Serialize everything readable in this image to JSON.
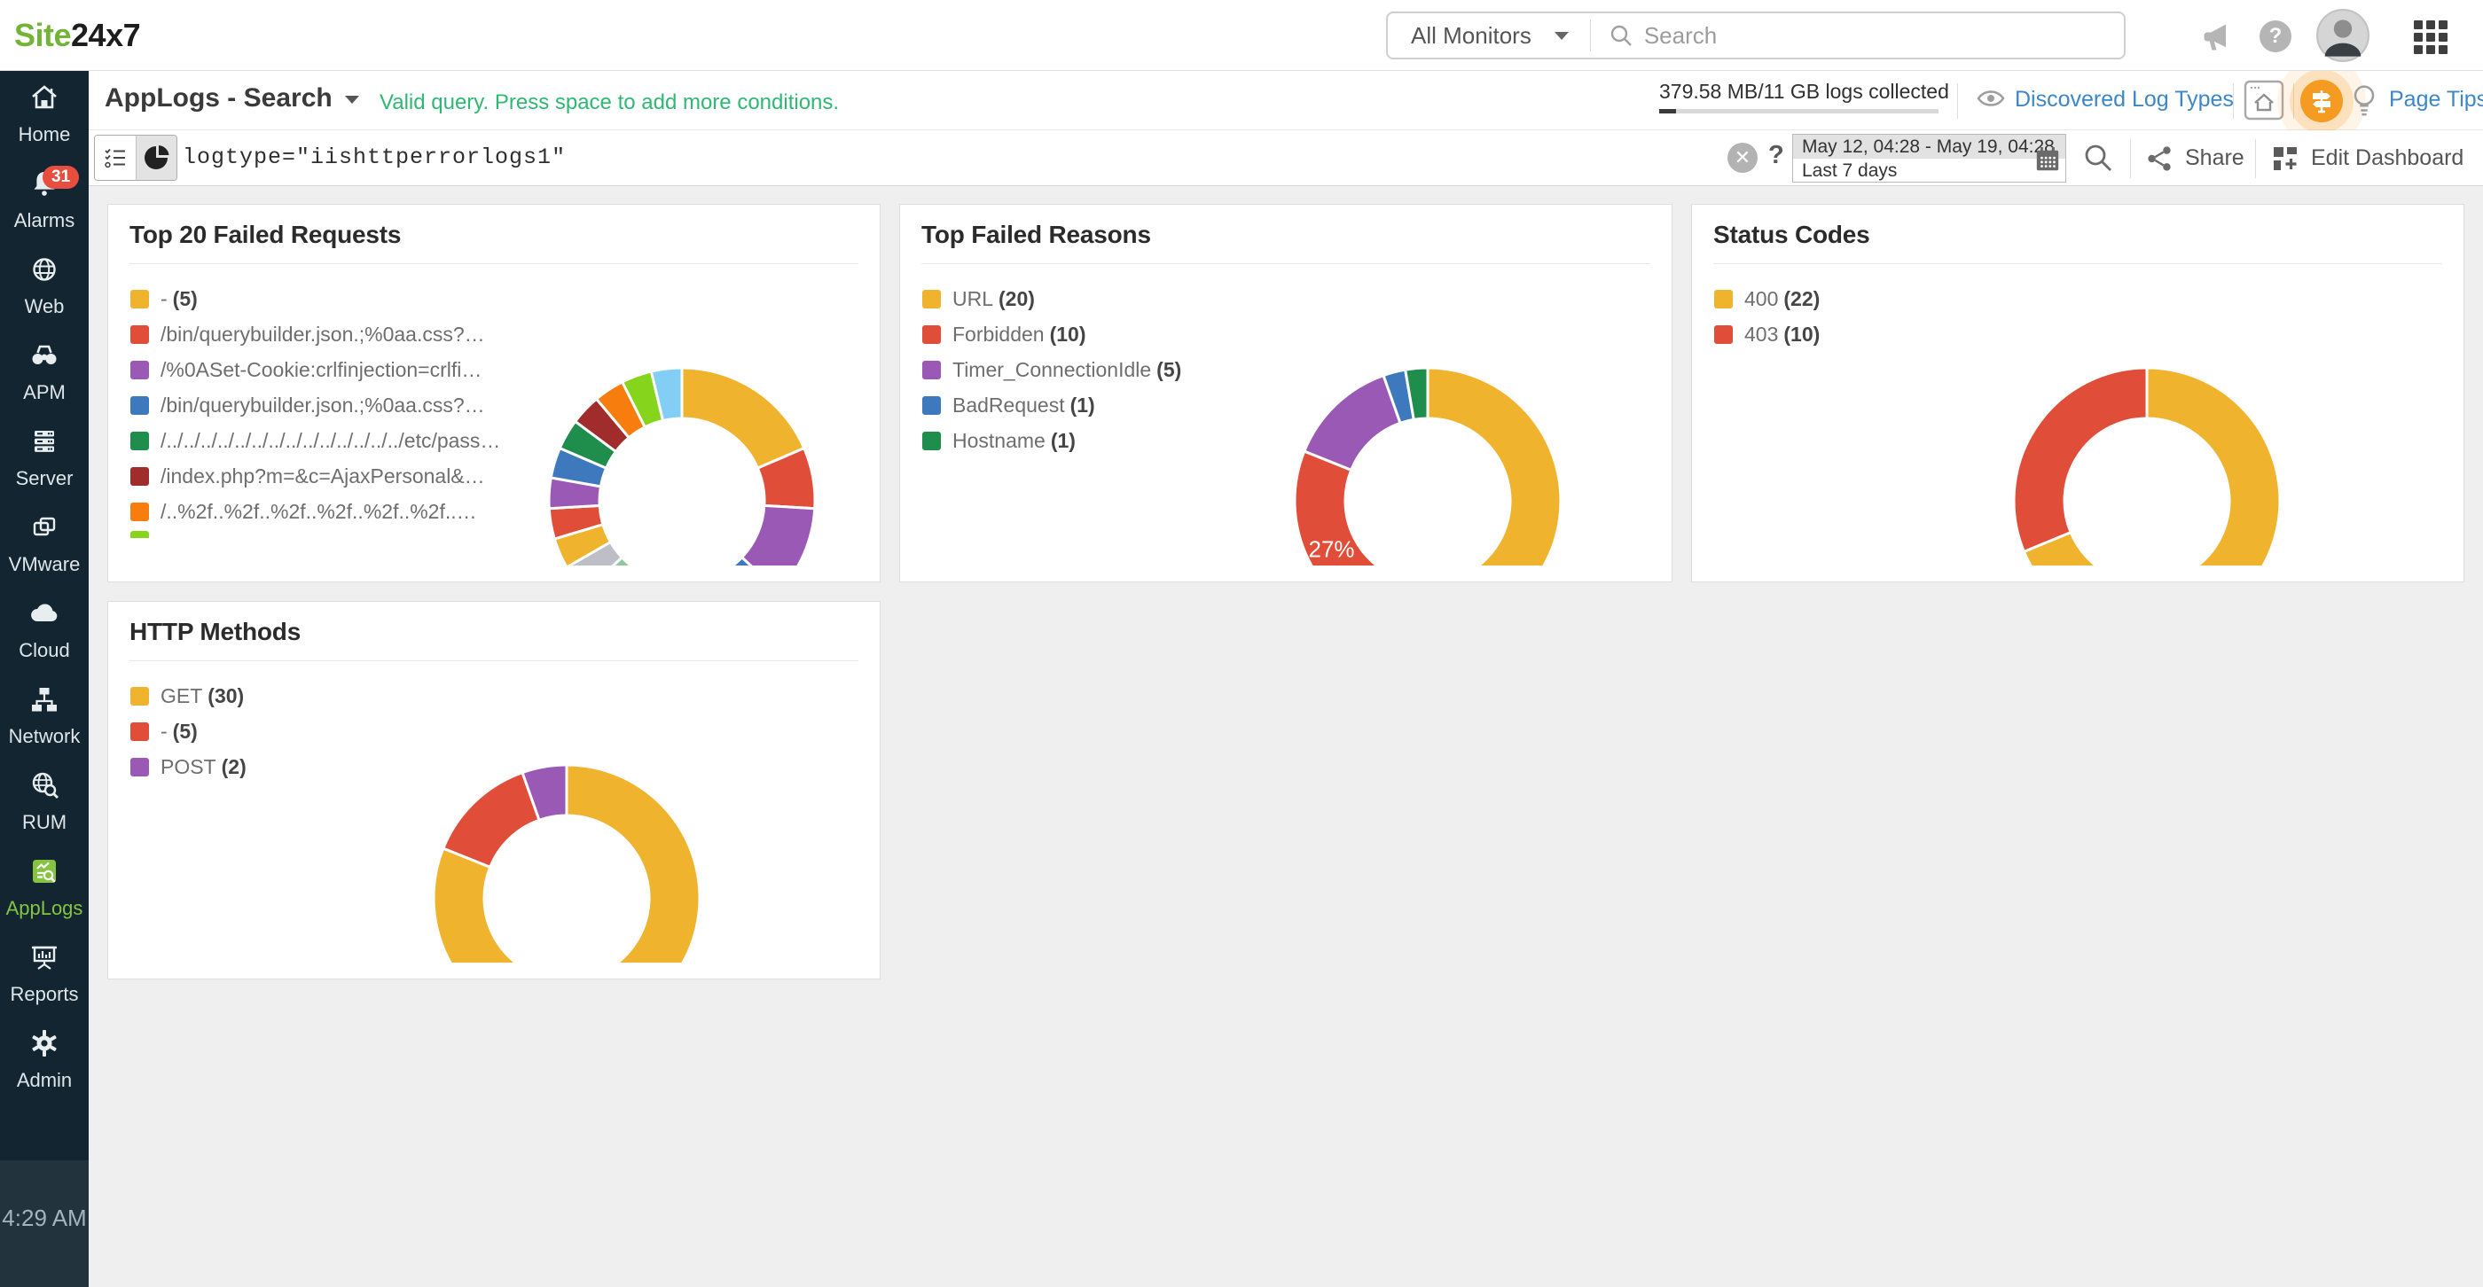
{
  "topbar": {
    "logo_green": "Site",
    "logo_dark": "24x7",
    "monitor_dropdown": "All Monitors",
    "search_placeholder": "Search"
  },
  "header": {
    "title": "AppLogs - Search",
    "hint": "Valid query. Press space to add more conditions.",
    "usage_text": "379.58 MB/11 GB logs collected",
    "usage_pct": 6,
    "discovered_link": "Discovered Log Types",
    "page_tips": "Page Tips"
  },
  "querybar": {
    "query": "logtype=\"iishttperrorlogs1\"",
    "date_range": "May 12, 04:28 - May 19, 04:28",
    "date_preset": "Last 7 days",
    "share_label": "Share",
    "edit_label": "Edit Dashboard"
  },
  "sidebar": {
    "items": [
      {
        "id": "home",
        "label": "Home"
      },
      {
        "id": "alarms",
        "label": "Alarms",
        "badge": "31"
      },
      {
        "id": "web",
        "label": "Web"
      },
      {
        "id": "apm",
        "label": "APM"
      },
      {
        "id": "server",
        "label": "Server"
      },
      {
        "id": "vmware",
        "label": "VMware"
      },
      {
        "id": "cloud",
        "label": "Cloud"
      },
      {
        "id": "network",
        "label": "Network"
      },
      {
        "id": "rum",
        "label": "RUM"
      },
      {
        "id": "applogs",
        "label": "AppLogs",
        "active": true
      },
      {
        "id": "reports",
        "label": "Reports"
      },
      {
        "id": "admin",
        "label": "Admin"
      }
    ],
    "time": "4:29 AM"
  },
  "colors": {
    "accent_green": "#85c440",
    "link_blue": "#3c87c6",
    "valid_green": "#2eb873",
    "alarm_red": "#e84e40",
    "sidebar_bg": "#132530",
    "tip_orange": "#f59b22"
  },
  "chart_data": [
    {
      "type": "donut",
      "title": "Top 20 Failed Requests",
      "legend": [
        {
          "label": "-",
          "count": "5",
          "color": "#F0B32E"
        },
        {
          "label": "/bin/querybuilder.json.;%0aa.css?…",
          "count": "",
          "color": "#E04E39"
        },
        {
          "label": "/%0ASet-Cookie:crlfinjection=crlfi…",
          "count": "",
          "color": "#9B59B6"
        },
        {
          "label": "/bin/querybuilder.json.;%0aa.css?…",
          "count": "",
          "color": "#3F79BD"
        },
        {
          "label": "/../../../../../../../../../../../../../../etc/pass…",
          "count": "",
          "color": "#1F8E4D"
        },
        {
          "label": "/index.php?m=&c=AjaxPersonal&…",
          "count": "",
          "color": "#A02C2C"
        },
        {
          "label": "/..%2f..%2f..%2f..%2f..%2f..%2f..…",
          "count": "",
          "color": "#F77E0E"
        }
      ],
      "legend_overflow_color": "#86D41C",
      "values": [
        5,
        2,
        3,
        1,
        1,
        1,
        1,
        1,
        1,
        1,
        1,
        1,
        1,
        1,
        1,
        1,
        1,
        1,
        1,
        1
      ],
      "segment_colors": [
        "#F0B32E",
        "#E04E39",
        "#9B59B6",
        "#3F79BD",
        "#1F8E4D",
        "#A02C2C",
        "#F77E0E",
        "#86D41C",
        "#82CEF5",
        "#8FC79B",
        "#BEBEC6",
        "#F0B32E",
        "#E04E39",
        "#9B59B6",
        "#3F79BD",
        "#1F8E4D",
        "#A02C2C",
        "#F77E0E",
        "#86D41C",
        "#82CEF5"
      ],
      "inner_label": null
    },
    {
      "type": "donut",
      "title": "Top Failed Reasons",
      "legend": [
        {
          "label": "URL",
          "count": "20",
          "color": "#F0B32E"
        },
        {
          "label": "Forbidden",
          "count": "10",
          "color": "#E04E39"
        },
        {
          "label": "Timer_ConnectionIdle",
          "count": "5",
          "color": "#9B59B6"
        },
        {
          "label": "BadRequest",
          "count": "1",
          "color": "#3F79BD"
        },
        {
          "label": "Hostname",
          "count": "1",
          "color": "#1F8E4D"
        }
      ],
      "values": [
        20,
        10,
        5,
        1,
        1
      ],
      "segment_colors": [
        "#F0B32E",
        "#E04E39",
        "#9B59B6",
        "#3F79BD",
        "#1F8E4D"
      ],
      "inner_label": {
        "text": "27%",
        "segment": 1
      }
    },
    {
      "type": "donut",
      "title": "Status Codes",
      "legend": [
        {
          "label": "400",
          "count": "22",
          "color": "#F0B32E"
        },
        {
          "label": "403",
          "count": "10",
          "color": "#E04E39"
        }
      ],
      "values": [
        22,
        10
      ],
      "segment_colors": [
        "#F0B32E",
        "#E04E39"
      ],
      "inner_label": null
    },
    {
      "type": "donut",
      "title": "HTTP Methods",
      "legend": [
        {
          "label": "GET",
          "count": "30",
          "color": "#F0B32E"
        },
        {
          "label": "-",
          "count": "5",
          "color": "#E04E39"
        },
        {
          "label": "POST",
          "count": "2",
          "color": "#9B59B6"
        }
      ],
      "values": [
        30,
        5,
        2
      ],
      "segment_colors": [
        "#F0B32E",
        "#E04E39",
        "#9B59B6"
      ],
      "inner_label": null
    }
  ]
}
